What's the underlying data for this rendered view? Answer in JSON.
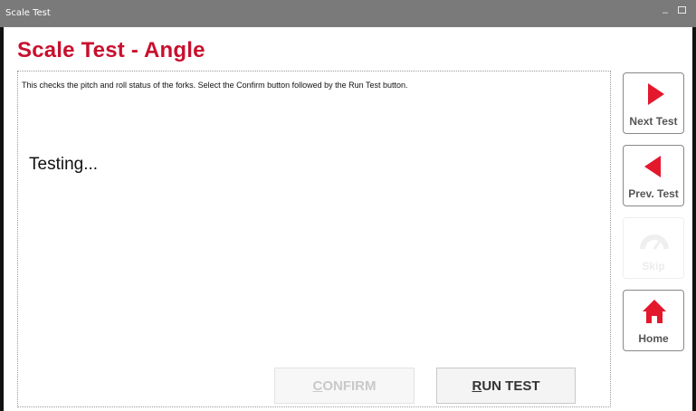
{
  "window": {
    "title": "Scale Test",
    "minimize_glyph": "–"
  },
  "page": {
    "heading": "Scale Test - Angle",
    "instructions": "This checks the pitch and roll status of the forks. Select the Confirm button followed by the Run Test button.",
    "status_text": "Testing..."
  },
  "actions": {
    "confirm_label": "CONFIRM",
    "run_test_label": "RUN TEST",
    "confirm_enabled": false
  },
  "nav": {
    "next_label": "Next Test",
    "prev_label": "Prev. Test",
    "skip_label": "Skip",
    "home_label": "Home",
    "skip_enabled": false
  },
  "colors": {
    "accent": "#c8102e",
    "icon_red": "#e3182d",
    "titlebar": "#7a7a7a"
  },
  "icons": [
    "play-right-icon",
    "play-left-icon",
    "gauge-icon",
    "home-icon"
  ]
}
